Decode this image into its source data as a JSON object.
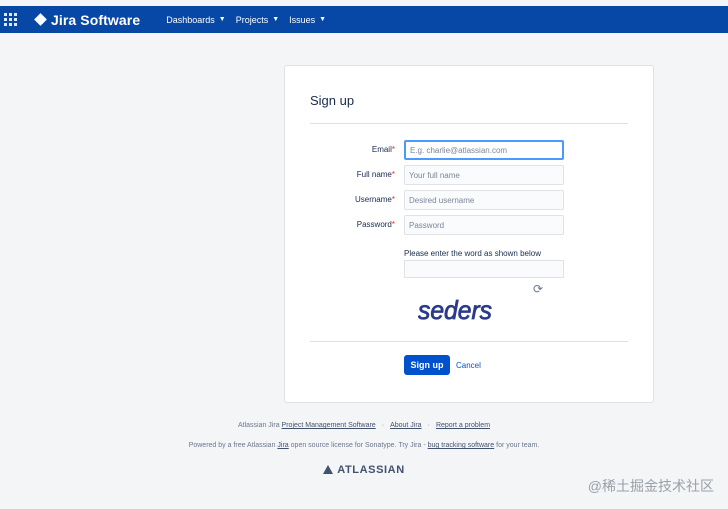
{
  "header": {
    "brand": "Jira Software",
    "nav": [
      "Dashboards",
      "Projects",
      "Issues"
    ]
  },
  "form": {
    "title": "Sign up",
    "fields": [
      {
        "label": "Email",
        "placeholder": "E.g. charlie@atlassian.com",
        "required": true
      },
      {
        "label": "Full name",
        "placeholder": "Your full name",
        "required": true
      },
      {
        "label": "Username",
        "placeholder": "Desired username",
        "required": true
      },
      {
        "label": "Password",
        "placeholder": "Password",
        "required": true
      }
    ],
    "captcha_label": "Please enter the word as shown below",
    "captcha_word": "seders",
    "submit_label": "Sign up",
    "cancel_label": "Cancel"
  },
  "footer": {
    "line1_prefix": "Atlassian Jira",
    "line1_link": "Project Management Software",
    "about": "About Jira",
    "report": "Report a problem",
    "line2_prefix": "Powered by a free Atlassian",
    "line2_jira": "Jira",
    "line2_mid": "open source license for Sonatype. Try Jira -",
    "line2_link": "bug tracking software",
    "line2_suffix": "for your team.",
    "brand": "ATLASSIAN"
  },
  "watermark": "@稀土掘金技术社区",
  "colors": {
    "header_bg": "#0747a6",
    "primary": "#0052cc",
    "required": "#de350b"
  }
}
